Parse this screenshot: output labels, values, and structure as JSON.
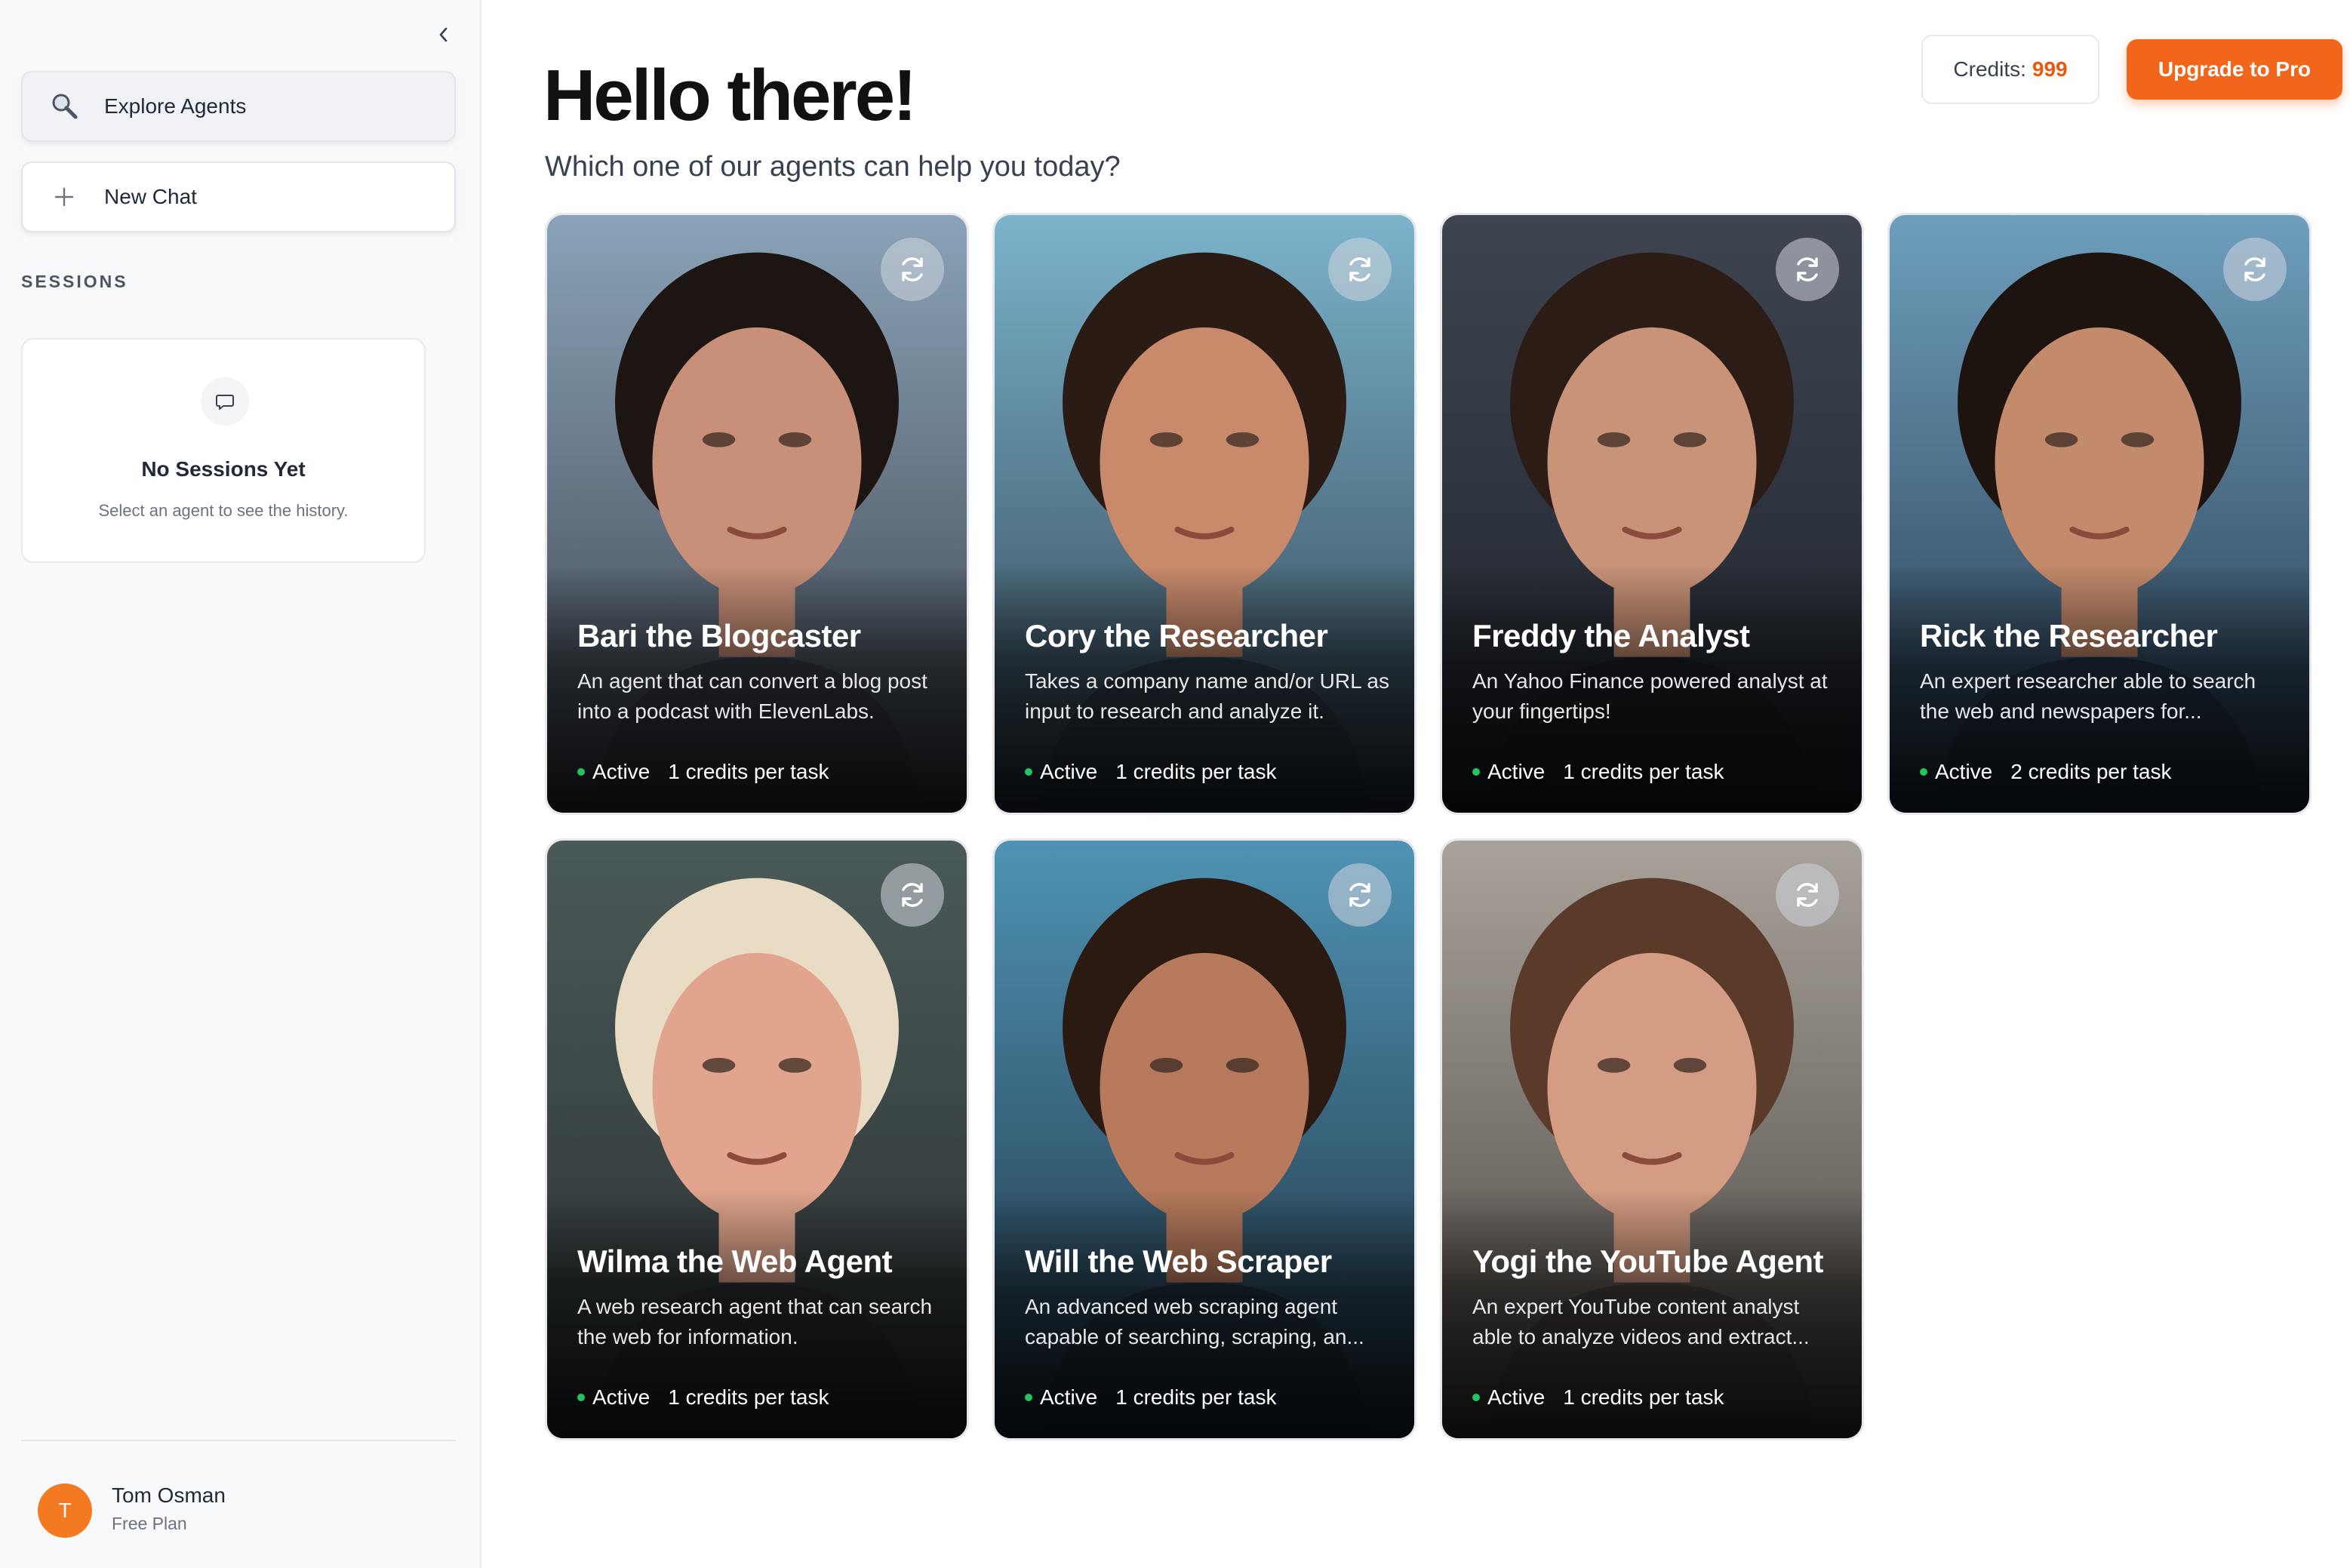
{
  "sidebar": {
    "explore_label": "Explore Agents",
    "new_chat_label": "New Chat",
    "sessions_title": "SESSIONS",
    "empty_title": "No Sessions Yet",
    "empty_subtitle": "Select an agent to see the history.",
    "user": {
      "initial": "T",
      "name": "Tom Osman",
      "plan": "Free Plan"
    }
  },
  "header": {
    "greeting": "Hello there!",
    "subtitle": "Which one of our agents can help you today?",
    "credits_label": "Credits:",
    "credits_value": "999",
    "upgrade_label": "Upgrade to Pro"
  },
  "colors": {
    "accent": "#f2661b",
    "status_active": "#22c55e"
  },
  "agents": [
    {
      "name": "Bari the Blogcaster",
      "description": "An agent that can convert a blog post into a podcast with ElevenLabs.",
      "status": "Active",
      "credits": "1 credits per task",
      "bg_top": "#8aa3b8",
      "bg_bottom": "#3a3f48",
      "skin": "#c89079",
      "hair": "#1c1512"
    },
    {
      "name": "Cory the Researcher",
      "description": "Takes a company name and/or URL as input to research and analyze it.",
      "status": "Active",
      "credits": "1 credits per task",
      "bg_top": "#7bb4cc",
      "bg_bottom": "#2f3e4c",
      "skin": "#c98a6c",
      "hair": "#2a1c14"
    },
    {
      "name": "Freddy the Analyst",
      "description": "An Yahoo Finance powered analyst at your fingertips!",
      "status": "Active",
      "credits": "1 credits per task",
      "bg_top": "#3e4550",
      "bg_bottom": "#1d2229",
      "skin": "#c99378",
      "hair": "#2b1d15"
    },
    {
      "name": "Rick the Researcher",
      "description": "An expert researcher able to search the web and newspapers for...",
      "status": "Active",
      "credits": "2 credits per task",
      "bg_top": "#6e9fbd",
      "bg_bottom": "#243548",
      "skin": "#c48a6c",
      "hair": "#1d1410"
    },
    {
      "name": "Wilma the Web Agent",
      "description": "A web research agent that can search the web for information.",
      "status": "Active",
      "credits": "1 credits per task",
      "bg_top": "#4a5a58",
      "bg_bottom": "#2b2f33",
      "skin": "#e0a58c",
      "hair": "#e8dcc4"
    },
    {
      "name": "Will the Web Scraper",
      "description": "An advanced web scraping agent capable of searching, scraping, an...",
      "status": "Active",
      "credits": "1 credits per task",
      "bg_top": "#4f93b4",
      "bg_bottom": "#1f3140",
      "skin": "#b77a5c",
      "hair": "#2a1a12"
    },
    {
      "name": "Yogi the YouTube Agent",
      "description": "An expert YouTube content analyst able to analyze videos and extract...",
      "status": "Active",
      "credits": "1 credits per task",
      "bg_top": "#a8a29a",
      "bg_bottom": "#4a4440",
      "skin": "#d49c82",
      "hair": "#5a3a28"
    }
  ]
}
